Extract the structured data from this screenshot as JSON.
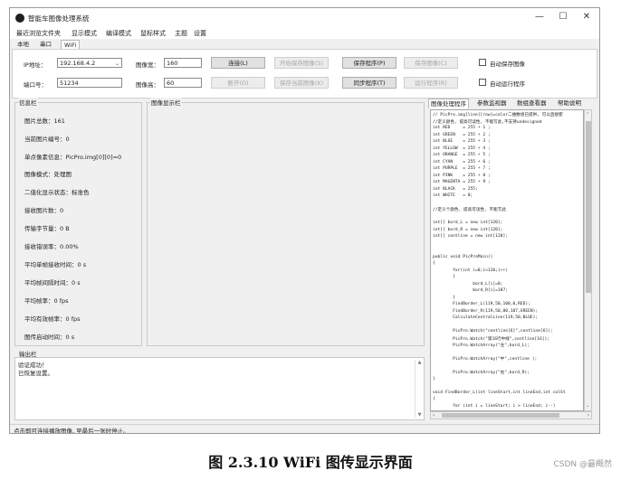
{
  "window": {
    "title": "智能车图像处理系统",
    "min_icon": "minimize-icon",
    "max_icon": "maximize-icon",
    "close_icon": "close-icon"
  },
  "menubar": [
    "最近浏览文件夹",
    "显示模式",
    "编译模式",
    "鼠标样式",
    "主题",
    "设置"
  ],
  "tabs": {
    "items": [
      "本地",
      "串口",
      "WiFi"
    ],
    "active": "WiFi"
  },
  "connection": {
    "ip_label": "IP地址：",
    "ip_value": "192.168.4.2",
    "port_label": "端口号：",
    "port_value": "51234",
    "img_width_label": "图像宽：",
    "img_width_value": "160",
    "img_height_label": "图像高：",
    "img_height_value": "60"
  },
  "buttons": {
    "row1": [
      {
        "label": "连接(L)",
        "enabled": true
      },
      {
        "label": "开始保存图像(S)",
        "enabled": false
      },
      {
        "label": "保存程序(P)",
        "enabled": true
      },
      {
        "label": "保存图像(C)",
        "enabled": false
      }
    ],
    "row2": [
      {
        "label": "断开(D)",
        "enabled": false
      },
      {
        "label": "保存当前图像(K)",
        "enabled": false
      },
      {
        "label": "同步程序(T)",
        "enabled": true
      },
      {
        "label": "运行程序(R)",
        "enabled": false
      }
    ]
  },
  "checkboxes": {
    "auto_save": "自动保存图像",
    "auto_run": "自动运行程序"
  },
  "info_panel": {
    "title": "信息栏",
    "lines": [
      "图片总数：161",
      "当前图片编号：0",
      "单点像素信息：PicPro.img[0][0]=0",
      "图像模式：处理图",
      "二值化显示状态：标准色",
      "接收图片数：0",
      "传输字节量：0 B",
      "接收错误率：0.00%",
      "平均单帧接收时间：0 s",
      "平均帧间隔时间：0 s",
      "平均帧率：0 fps",
      "平均有效帧率：0 fps",
      "图传启动时间：0 s"
    ]
  },
  "image_panel": {
    "title": "图像显示栏"
  },
  "output_panel": {
    "title": "输出栏",
    "lines": [
      "验证成功！",
      "已恢复设置。"
    ]
  },
  "right_tabs": {
    "items": [
      "图像处理程序",
      "参数监视器",
      "数组查看器",
      "帮助说明"
    ],
    "active": "图像处理程序"
  },
  "code_lines": [
    "// PicPro.img[line][row]=color二维数组已提供, 可以直接使",
    "//定义颜色, 提高可读性, 不能写此,不支持undesigned",
    "int RED     = 255 + 1 ;",
    "int GREEN   = 255 + 2 ;",
    "int BLUE    = 255 + 3 ;",
    "int YELLOW  = 255 + 4 ;",
    "int ORANGE  = 255 + 5 ;",
    "int CYAN    = 255 + 6 ;",
    "int PURPLE  = 255 + 7 ;",
    "int PINK    = 255 + 8 ;",
    "int MAGENTA = 255 + 9 ;",
    "int BLACK   = 255;",
    "int WHITE   = 0;",
    "",
    "//定义个颜色, 提高可读性, 不能写此",
    "",
    "int[] bord_L = new int[120];",
    "int[] bord_R = new int[120];",
    "int[] centline = new int[120];",
    "",
    "",
    "public void PicProMain()",
    "{",
    "        for(int i=0;i<120;i++)",
    "        {",
    "                bord_L[i]=0;",
    "                bord_R[i]=187;",
    "        }",
    "        FindBorder_L(119,50,100,0,RED);",
    "        FindBorder_R(119,50,80,187,GREEN);",
    "        CalculateCentralLine(119,50,BLUE);",
    "",
    "        PicPro.Watch(\"centline[6]\",centline[6]);",
    "        PicPro.Watch(\"第16行中线\",centline[16]);",
    "        PicPro.WatchArray(\"左\",bord_L);",
    "",
    "        PicPro.WatchArray(\"中\",centline );",
    "",
    "        PicPro.WatchArray(\"右\",bord_R);",
    "}",
    "",
    "void FindBorder_L(int lineStart,int lineEnd,int colSt",
    "{",
    "        for (int i = lineStart; i > lineEnd; i--)"
  ],
  "status_text": "点击即可连接播放图像, 至最后一张时停止。",
  "caption": "图 2.3.10 WiFi 图传显示界面",
  "watermark": "CSDN @最概然"
}
